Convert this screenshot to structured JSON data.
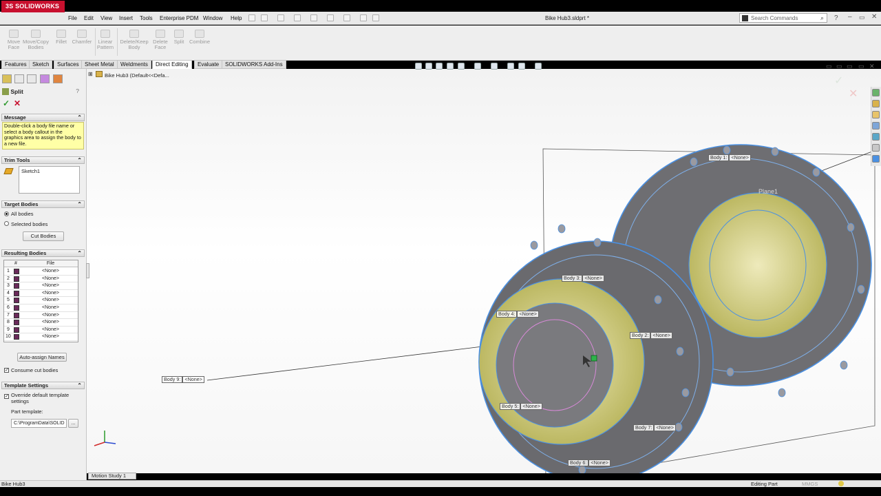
{
  "app": {
    "logo": "3S SOLIDWORKS",
    "document_title": "Bike Hub3.sldprt *"
  },
  "menu": [
    "File",
    "Edit",
    "View",
    "Insert",
    "Tools",
    "Enterprise PDM",
    "Window",
    "Help"
  ],
  "search": {
    "placeholder": "Search Commands"
  },
  "ribbon": {
    "move_face": [
      "Move",
      "Face"
    ],
    "move_copy": [
      "Move/Copy",
      "Bodies"
    ],
    "fillet": "Fillet",
    "chamfer": "Chamfer",
    "linear_pattern": [
      "Linear",
      "Pattern"
    ],
    "delete_keep": [
      "Delete/Keep",
      "Body"
    ],
    "delete_face": [
      "Delete",
      "Face"
    ],
    "split": "Split",
    "combine": "Combine"
  },
  "tabs": [
    "Features",
    "Sketch",
    "Surfaces",
    "Sheet Metal",
    "Weldments",
    "Direct Editing",
    "Evaluate",
    "SOLIDWORKS Add-Ins"
  ],
  "tree": {
    "root": "Bike Hub3  (Default<<Defa..."
  },
  "pm": {
    "title": "Split",
    "message_header": "Message",
    "message": "Double-click a body file name or select a body callout in the graphics area to assign the body to a new file.",
    "trim_header": "Trim Tools",
    "trim_item": "Sketch1",
    "target_header": "Target Bodies",
    "all_bodies": "All bodies",
    "selected_bodies": "Selected bodies",
    "cut_bodies": "Cut Bodies",
    "resulting_header": "Resulting Bodies",
    "col_file": "File",
    "col_num": "#",
    "rows": [
      "1",
      "2",
      "3",
      "4",
      "5",
      "6",
      "7",
      "8",
      "9",
      "10"
    ],
    "row_value": "<None>",
    "auto_assign": "Auto-assign Names",
    "consume": "Consume cut bodies",
    "template_header": "Template Settings",
    "override": "Override default template settings",
    "part_template": "Part template:",
    "template_path": "C:\\ProgramData\\SOLID",
    "browse": "..."
  },
  "callouts": {
    "b1": "Body 1:",
    "b3": "Body 3:",
    "b4": "Body 4:",
    "b2": "Body 2:",
    "b9": "Body 9:",
    "b5": "Body 5:",
    "b7": "Body 7:",
    "b6": "Body 6:",
    "none": "<None>"
  },
  "plane_label": "Plane1",
  "motion_tab": "Motion Study 1",
  "status": {
    "left": "Bike Hub3",
    "right": "Editing Part",
    "units": "MMGS"
  },
  "colors": {
    "accent": "#c8102e",
    "model_yellow": "#d8d48a",
    "edge_blue": "#4a90e2",
    "body_grey": "#6e6e72"
  }
}
